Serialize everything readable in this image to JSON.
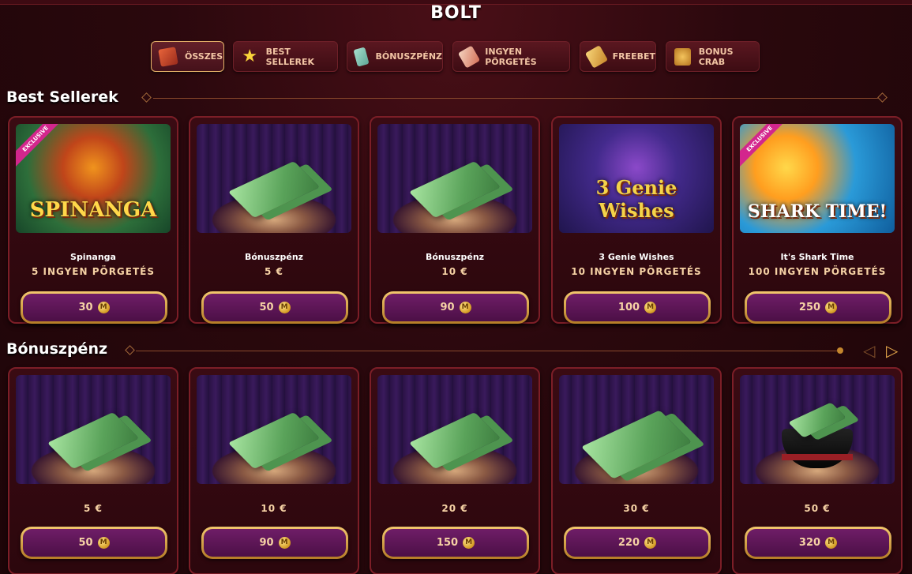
{
  "page": {
    "title": "BOLT"
  },
  "tabs": [
    {
      "label": "ÖSSZES",
      "icon": "book-icon",
      "active": true
    },
    {
      "label": "BEST SELLEREK",
      "icon": "star-icon"
    },
    {
      "label": "BÓNUSZPÉNZ",
      "icon": "money-icon"
    },
    {
      "label": "INGYEN PÖRGETÉS",
      "icon": "ticket-icon"
    },
    {
      "label": "FREEBET",
      "icon": "gold-bar-icon"
    },
    {
      "label": "BONUS CRAB",
      "icon": "crab-icon"
    }
  ],
  "sections": {
    "bestsellers": {
      "title": "Best Sellerek"
    },
    "bonus": {
      "title": "Bónuszpénz"
    }
  },
  "bestsellers": [
    {
      "name": "Spinanga",
      "sub": "5 INGYEN PÖRGETÉS",
      "price": "30",
      "art": "SPINANGA",
      "badge": "EXCLUSIVE"
    },
    {
      "name": "Bónuszpénz",
      "sub": "5 €",
      "price": "50"
    },
    {
      "name": "Bónuszpénz",
      "sub": "10 €",
      "price": "90"
    },
    {
      "name": "3 Genie Wishes",
      "sub": "10 INGYEN PÖRGETÉS",
      "price": "100",
      "art": "3 Genie Wishes"
    },
    {
      "name": "It's Shark Time",
      "sub": "100 INGYEN PÖRGETÉS",
      "price": "250",
      "art": "SHARK TIME!",
      "badge": "EXCLUSIVE"
    }
  ],
  "bonus": [
    {
      "sub": "5 €",
      "price": "50"
    },
    {
      "sub": "10 €",
      "price": "90"
    },
    {
      "sub": "20 €",
      "price": "150"
    },
    {
      "sub": "30 €",
      "price": "220"
    },
    {
      "sub": "50 €",
      "price": "320"
    }
  ],
  "coin_symbol": "M",
  "colors": {
    "accent": "#e7b46a",
    "button": "#6f1d67",
    "card_border": "#7c1e27",
    "background": "#2a080d"
  }
}
